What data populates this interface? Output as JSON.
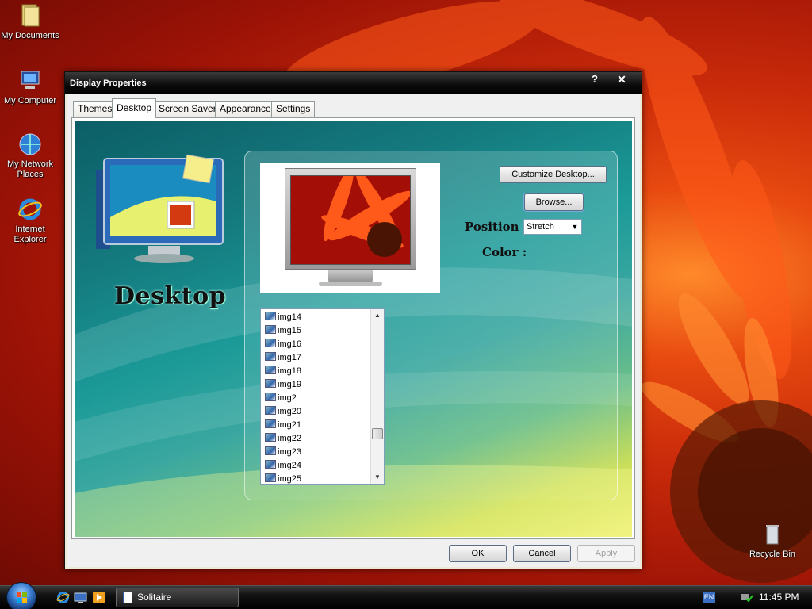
{
  "desktop_icons": [
    {
      "label": "My Documents",
      "icon": "folder-icon"
    },
    {
      "label": "My Computer",
      "icon": "computer-icon"
    },
    {
      "label": "My Network Places",
      "icon": "network-icon"
    },
    {
      "label": "Internet Explorer",
      "icon": "ie-icon"
    },
    {
      "label": "Recycle Bin",
      "icon": "recycle-bin-icon"
    }
  ],
  "dialog": {
    "title": "Display Properties",
    "help_label": "?",
    "close_label": "✕",
    "tabs": [
      {
        "label": "Themes"
      },
      {
        "label": "Desktop",
        "active": true
      },
      {
        "label": "Screen Saver"
      },
      {
        "label": "Appearance"
      },
      {
        "label": "Settings"
      }
    ],
    "desktop_tab": {
      "caption": "Desktop",
      "customize_label": "Customize Desktop...",
      "browse_label": "Browse...",
      "position_label": "Position :",
      "position_value": "Stretch",
      "color_label": "Color :",
      "backgrounds": [
        "img14",
        "img15",
        "img16",
        "img17",
        "img18",
        "img19",
        "img2",
        "img20",
        "img21",
        "img22",
        "img23",
        "img24",
        "img25"
      ]
    },
    "buttons": {
      "ok": "OK",
      "cancel": "Cancel",
      "apply": "Apply"
    }
  },
  "taskbar": {
    "items": [
      {
        "label": "Solitaire"
      }
    ],
    "language": "EN",
    "clock": "11:45 PM"
  },
  "colors": {
    "accent": "#3c7fd0",
    "wallpaper": "#c92a0a"
  }
}
